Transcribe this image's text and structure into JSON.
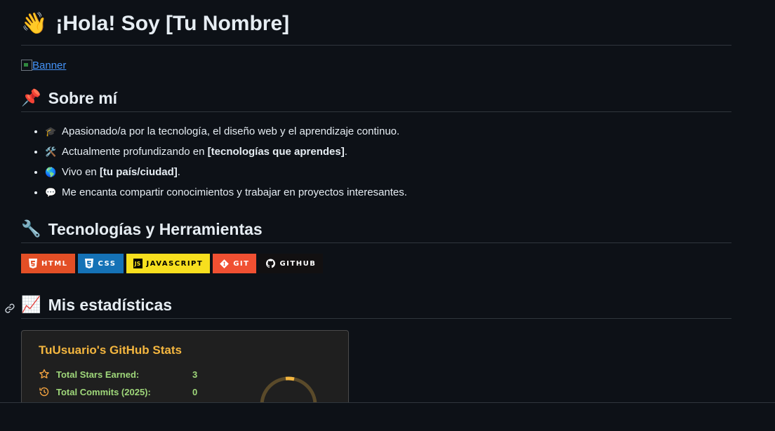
{
  "header": {
    "emoji": "👋",
    "title": "¡Hola! Soy [Tu Nombre]"
  },
  "banner": {
    "alt": "Banner"
  },
  "about": {
    "emoji": "📌",
    "heading": "Sobre mí",
    "items": [
      {
        "emoji": "🎓",
        "text_before": "Apasionado/a por la tecnología, el diseño web y el aprendizaje continuo.",
        "bold": "",
        "text_after": ""
      },
      {
        "emoji": "🛠️",
        "text_before": "Actualmente profundizando en ",
        "bold": "[tecnologías que aprendes]",
        "text_after": "."
      },
      {
        "emoji": "🌎",
        "text_before": "Vivo en ",
        "bold": "[tu país/ciudad]",
        "text_after": "."
      },
      {
        "emoji": "💬",
        "text_before": "Me encanta compartir conocimientos y trabajar en proyectos interesantes.",
        "bold": "",
        "text_after": ""
      }
    ]
  },
  "tech": {
    "emoji": "🔧",
    "heading": "Tecnologías y Herramientas",
    "badges": [
      {
        "label": "HTML",
        "icon": "html5-icon",
        "color": "#e34f26"
      },
      {
        "label": "CSS",
        "icon": "css3-icon",
        "color": "#1572b6"
      },
      {
        "label": "JAVASCRIPT",
        "icon": "javascript-icon",
        "color": "#f7df1e"
      },
      {
        "label": "GIT",
        "icon": "git-icon",
        "color": "#f05032"
      },
      {
        "label": "GITHUB",
        "icon": "github-icon",
        "color": "#121011"
      }
    ]
  },
  "stats": {
    "emoji": "📈",
    "heading": "Mis estadísticas",
    "card_title": "TuUsuario's GitHub Stats",
    "rows": [
      {
        "label": "Total Stars Earned:",
        "value": "3",
        "icon": "star-icon"
      },
      {
        "label": "Total Commits (2025):",
        "value": "0",
        "icon": "history-icon"
      }
    ],
    "colors": {
      "title": "#f4b63f",
      "text": "#9fd77a",
      "icon": "#f4a340",
      "ring": "#f4b63f"
    }
  }
}
